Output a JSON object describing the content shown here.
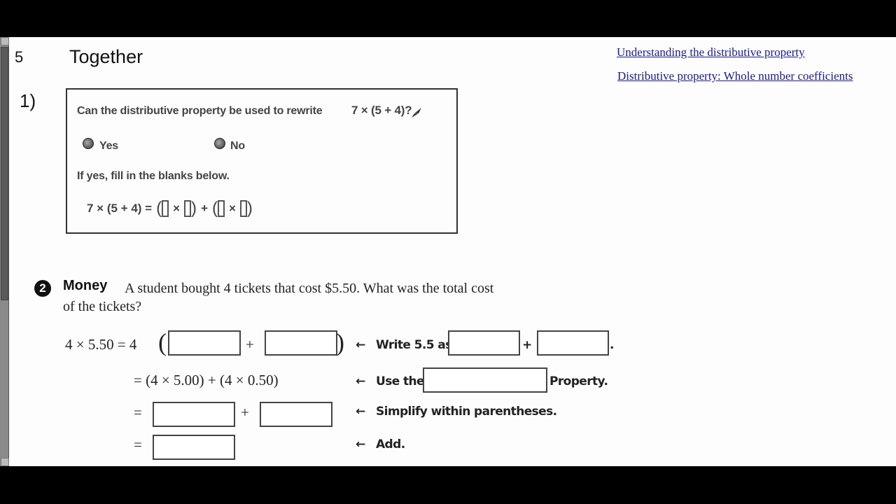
{
  "section": {
    "number": "5",
    "title": "Together"
  },
  "links": [
    {
      "label": "Understanding the distributive property"
    },
    {
      "label": "Distributive property: Whole number coefficients"
    }
  ],
  "question1": {
    "number": "1)",
    "prompt": "Can the distributive property be used to rewrite",
    "expression": "7 × (5 + 4)?",
    "options": [
      {
        "label": "Yes",
        "selected": false
      },
      {
        "label": "No",
        "selected": false
      }
    ],
    "instruction": "If yes, fill in the blanks below.",
    "equation": {
      "lhs": "7 × (5 + 4) =",
      "times": "×",
      "plus": "+",
      "blanks": [
        "",
        "",
        "",
        ""
      ]
    }
  },
  "question2": {
    "icon": "2",
    "heading": "Money",
    "text_line1": "A student bought 4 tickets that cost $5.50. What was the total cost",
    "text_line2": "of the tickets?",
    "steps": [
      {
        "lhs": "4 × 5.50 = 4",
        "plus": "+",
        "hint_arrow": "←",
        "hint": "Write 5.5 as",
        "hint_plus": "+",
        "hint_end": ".",
        "blanks": [
          "",
          "",
          "",
          ""
        ]
      },
      {
        "lhs": "= (4 × 5.00) + (4 × 0.50)",
        "hint_arrow": "←",
        "hint": "Use the",
        "hint_end": "Property.",
        "blanks": [
          ""
        ]
      },
      {
        "lhs": "=",
        "plus": "+",
        "hint_arrow": "←",
        "hint": "Simplify within parentheses.",
        "blanks": [
          "",
          ""
        ]
      },
      {
        "lhs": "=",
        "hint_arrow": "←",
        "hint": "Add.",
        "blanks": [
          ""
        ]
      }
    ]
  },
  "colors": {
    "link": "#1a1a8c",
    "page_bg": "#fdfdfd",
    "frame": "#000000"
  }
}
